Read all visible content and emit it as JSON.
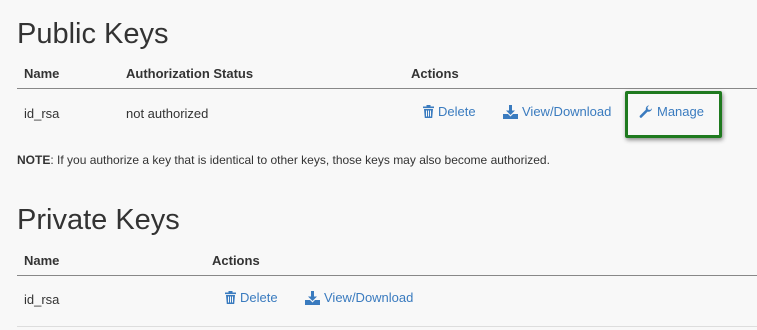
{
  "public_keys": {
    "title": "Public Keys",
    "headers": {
      "name": "Name",
      "status": "Authorization Status",
      "actions": "Actions"
    },
    "rows": [
      {
        "name": "id_rsa",
        "status": "not authorized",
        "delete_label": "Delete",
        "download_label": "View/Download",
        "manage_label": "Manage"
      }
    ],
    "note_label": "NOTE",
    "note_text": ": If you authorize a key that is identical to other keys, those keys may also become authorized."
  },
  "private_keys": {
    "title": "Private Keys",
    "headers": {
      "name": "Name",
      "actions": "Actions"
    },
    "rows": [
      {
        "name": "id_rsa",
        "delete_label": "Delete",
        "download_label": "View/Download"
      }
    ]
  },
  "colors": {
    "link": "#3a7bbf",
    "highlight": "#1f7a1f",
    "text": "#333333",
    "background": "#f8f8f8"
  },
  "icons": {
    "delete": "trash-icon",
    "download": "download-icon",
    "manage": "wrench-icon"
  }
}
